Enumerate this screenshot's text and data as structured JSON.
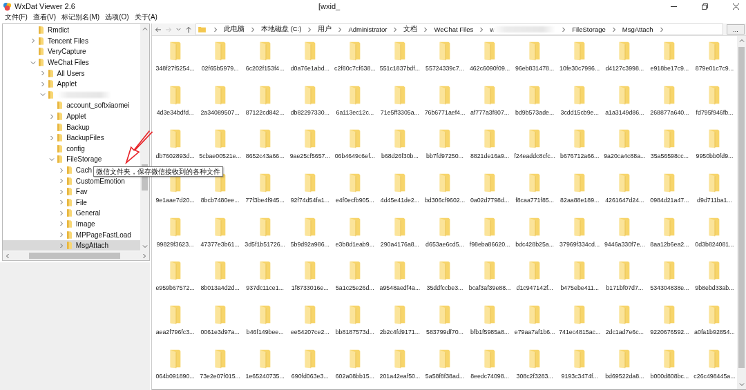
{
  "window": {
    "title": "WxDat Viewer 2.6",
    "subtitle": "[wxid_"
  },
  "menu": [
    "文件(F)",
    "查看(V)",
    "标记别名(M)",
    "选项(O)",
    "关于(A)"
  ],
  "tree": [
    {
      "label": "Rmdict",
      "expandable": false,
      "selected": false
    },
    {
      "label": "Tencent Files",
      "expandable": true,
      "expanded": false,
      "selected": false
    },
    {
      "label": "VeryCapture",
      "expandable": false,
      "selected": false
    },
    {
      "label": "WeChat Files",
      "expandable": true,
      "expanded": true,
      "selected": false,
      "children": [
        {
          "label": "All Users",
          "expandable": true,
          "expanded": false,
          "selected": false
        },
        {
          "label": "Applet",
          "expandable": true,
          "expanded": false,
          "selected": false
        },
        {
          "redacted": true,
          "expandable": true,
          "expanded": true,
          "selected": false,
          "children": [
            {
              "label": "account_softxiaomei",
              "expandable": false,
              "selected": false
            },
            {
              "label": "Applet",
              "expandable": true,
              "expanded": false,
              "selected": false
            },
            {
              "label": "Backup",
              "expandable": false,
              "selected": false
            },
            {
              "label": "BackupFiles",
              "expandable": true,
              "expanded": false,
              "selected": false
            },
            {
              "label": "config",
              "expandable": false,
              "selected": false
            },
            {
              "label": "FileStorage",
              "expandable": true,
              "expanded": true,
              "selected": false,
              "children": [
                {
                  "label": "Cach",
                  "expandable": true,
                  "expanded": false,
                  "selected": false
                },
                {
                  "label": "CustomEmotion",
                  "expandable": true,
                  "expanded": false,
                  "selected": false
                },
                {
                  "label": "Fav",
                  "expandable": true,
                  "expanded": false,
                  "selected": false
                },
                {
                  "label": "File",
                  "expandable": true,
                  "expanded": false,
                  "selected": false
                },
                {
                  "label": "General",
                  "expandable": true,
                  "expanded": false,
                  "selected": false
                },
                {
                  "label": "Image",
                  "expandable": true,
                  "expanded": false,
                  "selected": false
                },
                {
                  "label": "MPPageFastLoad",
                  "expandable": true,
                  "expanded": false,
                  "selected": false
                },
                {
                  "label": "MsgAttach",
                  "expandable": true,
                  "expanded": false,
                  "selected": true
                }
              ]
            }
          ]
        }
      ]
    }
  ],
  "tooltip": "微信文件夹，保存微信接收到的各种文件",
  "address": [
    {
      "label": "此电脑"
    },
    {
      "label": "本地磁盘 (C:)"
    },
    {
      "label": "用户"
    },
    {
      "label": "Administrator"
    },
    {
      "label": "文档"
    },
    {
      "label": "WeChat Files"
    },
    {
      "label": "w",
      "redacted": true
    },
    {
      "label": "FileStorage"
    },
    {
      "label": "MsgAttach"
    }
  ],
  "address_button": "...",
  "nav": [
    {
      "kind": "back",
      "disabled": false
    },
    {
      "kind": "forward",
      "disabled": true
    },
    {
      "kind": "recent",
      "disabled": false
    },
    {
      "kind": "up",
      "disabled": false
    }
  ],
  "folders": [
    "348f27f5254...",
    "02f65b5979...",
    "6c202f153f4...",
    "d0a76e1abd...",
    "c2f80c7cf638...",
    "551c1837bdf...",
    "55724339c7...",
    "462c6090f09...",
    "96eb831478...",
    "10fe30c7996...",
    "d4127c3998...",
    "e918be17c9...",
    "879e01c7c9...",
    "4d3e34bdfd...",
    "2a34089507...",
    "87122cd842...",
    "db82297330...",
    "6a113ec12c...",
    "71e5ff3305a...",
    "76b6771aef4...",
    "af777a3f807...",
    "bd9b573ade...",
    "3cdd15cb9e...",
    "a1a3149d86...",
    "268877a640...",
    "fd795f946fb...",
    "db7602893d...",
    "5cbae00521e...",
    "8652c43a66...",
    "9ae25cf5657...",
    "06b4649c6ef...",
    "b68d26f30b...",
    "bb7fd97250...",
    "8821de16a9...",
    "f24eaddc8cfc...",
    "b676712a66...",
    "9a20ca4c88a...",
    "35a56598cc...",
    "9950bb0fd9...",
    "9e1aae7d20...",
    "8bcb7480ee...",
    "77f3be4f945...",
    "92f74d54fa1...",
    "e4f0ecfb905...",
    "4d45e41de2...",
    "bd306cf9602...",
    "0a02d7798d...",
    "f8caa771f85...",
    "82aa88e189...",
    "4261647d24...",
    "0984d21a47...",
    "d9d711ba1...",
    "99829f3623...",
    "47377e3b61...",
    "3d5f1b51726...",
    "5b9d92a986...",
    "e3b8d1eab9...",
    "290a4176a8...",
    "d653ae6cd5...",
    "f98eba86620...",
    "bdc428b25a...",
    "37969f334cd...",
    "9446a330f7e...",
    "8aa12b6ea2...",
    "0d3b824081...",
    "e959b67572...",
    "8b013a4d2d...",
    "937dc11ce1...",
    "1f8733016e...",
    "5a1c25e26d...",
    "a9548aedf4a...",
    "35ddfccbe3...",
    "bcaf3af39e88...",
    "d1c947142f...",
    "b475ebe411...",
    "b171bf07d7...",
    "534304838e...",
    "9b8ebd33ab...",
    "aea2f796fc3...",
    "0061e3d97a...",
    "b46f149bee...",
    "ee54207ce2...",
    "bb8187573d...",
    "2b2c4fd9171...",
    "583799df70...",
    "bfb1f5985a8...",
    "e79aa7af1b6...",
    "741ec4815ac...",
    "2dc1ad7e6c...",
    "9220676592...",
    "a0fa1b92854...",
    "064b091890...",
    "73e2e07f015...",
    "1e65240735...",
    "690fd063e3...",
    "602a08bb15...",
    "201a42eaf50...",
    "5a58f8f38ad...",
    "8eedc74098...",
    "308c2f3283...",
    "9193c3474f...",
    "bd69522da8...",
    "b000d808bc...",
    "c26c498445a..."
  ]
}
